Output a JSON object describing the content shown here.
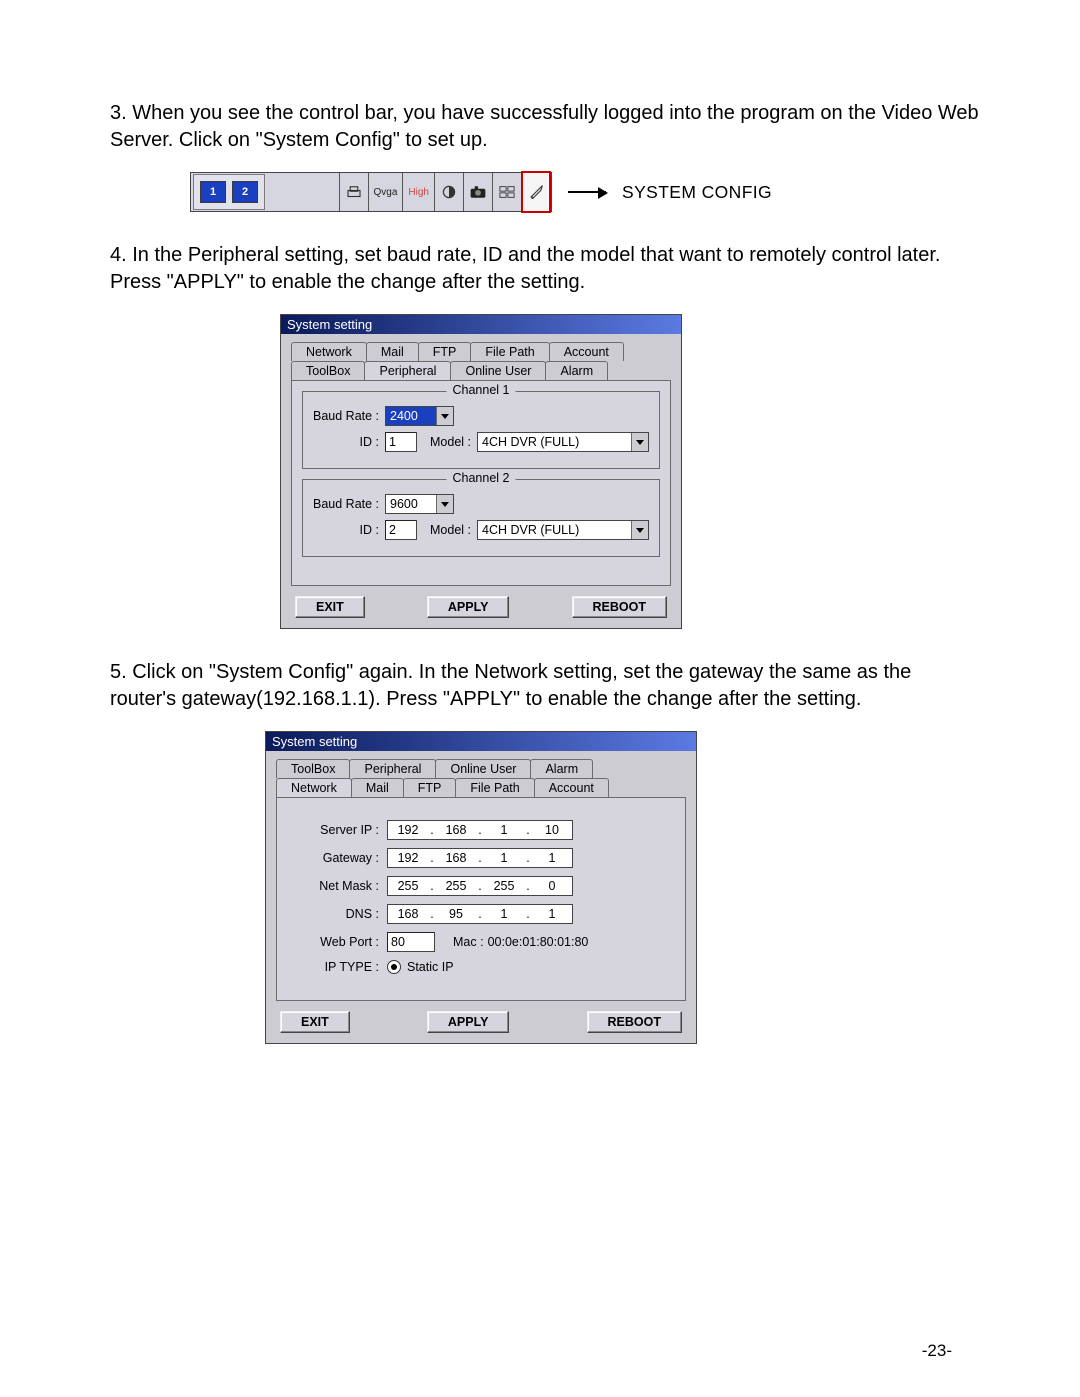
{
  "step3": "3. When you see the control bar, you have successfully logged into the program on the Video Web Server. Click on \"System Config\" to set up.",
  "step4": "4. In the Peripheral setting, set baud rate, ID and the model that want to remotely control later. Press \"APPLY\" to enable the change after the setting.",
  "step5": "5. Click on \"System Config\" again. In the Network setting, set the gateway the same as the router's gateway(192.168.1.1). Press \"APPLY\" to enable the change after the setting.",
  "control_bar": {
    "monitor1": "1",
    "monitor2": "2",
    "qvga": "Qvga",
    "high": "High",
    "sys_config_label": "SYSTEM CONFIG"
  },
  "dialog_peripheral": {
    "title": "System setting",
    "tabs_row1": [
      "Network",
      "Mail",
      "FTP",
      "File Path",
      "Account"
    ],
    "tabs_row2": [
      "ToolBox",
      "Peripheral",
      "Online User",
      "Alarm"
    ],
    "active_tab": "Peripheral",
    "channel1": {
      "legend": "Channel 1",
      "baud_label": "Baud Rate :",
      "baud_value": "2400",
      "id_label": "ID :",
      "id_value": "1",
      "model_label": "Model :",
      "model_value": "4CH DVR (FULL)"
    },
    "channel2": {
      "legend": "Channel 2",
      "baud_label": "Baud Rate :",
      "baud_value": "9600",
      "id_label": "ID :",
      "id_value": "2",
      "model_label": "Model :",
      "model_value": "4CH DVR (FULL)"
    },
    "btn_exit": "EXIT",
    "btn_apply": "APPLY",
    "btn_reboot": "REBOOT"
  },
  "dialog_network": {
    "title": "System setting",
    "tabs_row1": [
      "ToolBox",
      "Peripheral",
      "Online User",
      "Alarm"
    ],
    "tabs_row2": [
      "Network",
      "Mail",
      "FTP",
      "File Path",
      "Account"
    ],
    "active_tab": "Network",
    "server_ip_label": "Server IP :",
    "server_ip": [
      "192",
      "168",
      "1",
      "10"
    ],
    "gateway_label": "Gateway :",
    "gateway": [
      "192",
      "168",
      "1",
      "1"
    ],
    "netmask_label": "Net Mask :",
    "netmask": [
      "255",
      "255",
      "255",
      "0"
    ],
    "dns_label": "DNS :",
    "dns": [
      "168",
      "95",
      "1",
      "1"
    ],
    "webport_label": "Web Port :",
    "webport": "80",
    "mac_label": "Mac :",
    "mac_value": "00:0e:01:80:01:80",
    "iptype_label": "IP TYPE :",
    "iptype_value": "Static IP",
    "btn_exit": "EXIT",
    "btn_apply": "APPLY",
    "btn_reboot": "REBOOT"
  },
  "page_number": "-23-"
}
